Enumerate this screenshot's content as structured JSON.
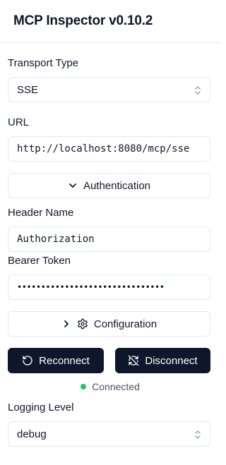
{
  "app": {
    "title": "MCP Inspector v0.10.2"
  },
  "transport": {
    "label": "Transport Type",
    "value": "SSE"
  },
  "url": {
    "label": "URL",
    "value": "http://localhost:8080/mcp/sse"
  },
  "authentication": {
    "button_label": "Authentication",
    "expanded": true
  },
  "header_name": {
    "label": "Header Name",
    "value": "Authorization"
  },
  "bearer_token": {
    "label": "Bearer Token",
    "masked_value": "•••••••••••••••••••••••••••••••"
  },
  "configuration": {
    "button_label": "Configuration",
    "expanded": false
  },
  "actions": {
    "reconnect_label": "Reconnect",
    "disconnect_label": "Disconnect"
  },
  "connection": {
    "status": "Connected",
    "status_color": "#22c55e"
  },
  "logging": {
    "label": "Logging Level",
    "value": "debug"
  },
  "colors": {
    "primary": "#0f172a",
    "border": "#e2e8f0",
    "muted_text": "#4b5563"
  }
}
